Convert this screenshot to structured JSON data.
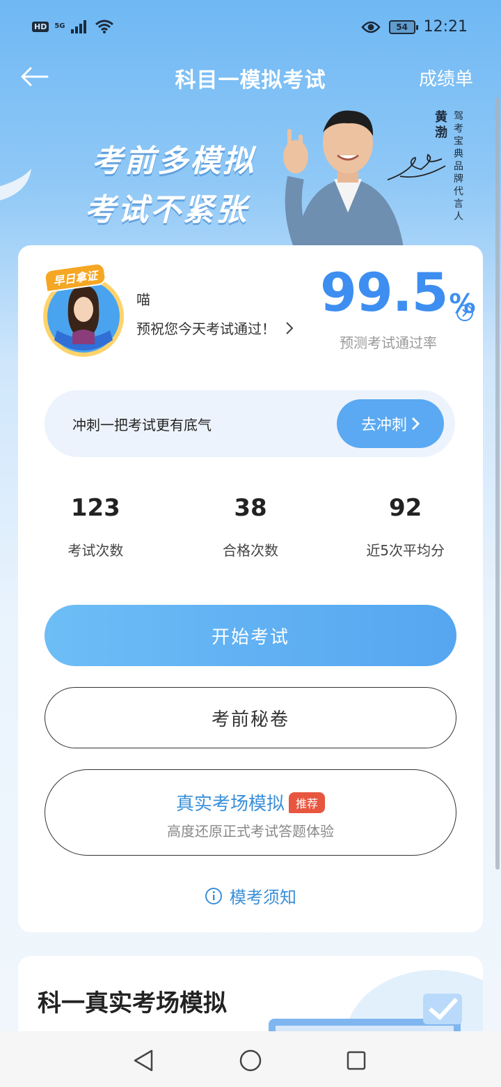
{
  "status_bar": {
    "hd": "HD",
    "network": "5G",
    "battery": "54",
    "time": "12:21"
  },
  "nav": {
    "title": "科目一模拟考试",
    "right_action": "成绩单"
  },
  "banner": {
    "slogan_line1": "考前多模拟",
    "slogan_line2": "考试不紧张",
    "celebrity_name": "黄渤",
    "endorsement": "驾考宝典品牌代言人"
  },
  "profile": {
    "badge": "早日拿证",
    "user_name": "喵",
    "wish": "预祝您今天考试通过！",
    "pass_rate": "99.5",
    "pass_rate_unit": "%",
    "pass_rate_label": "预测考试通过率"
  },
  "sprint": {
    "text": "冲刺一把考试更有底气",
    "button": "去冲刺"
  },
  "stats": [
    {
      "value": "123",
      "label": "考试次数"
    },
    {
      "value": "38",
      "label": "合格次数"
    },
    {
      "value": "92",
      "label": "近5次平均分"
    }
  ],
  "buttons": {
    "start_exam": "开始考试",
    "secret_paper": "考前秘卷",
    "real_exam_title": "真实考场模拟",
    "real_exam_badge": "推荐",
    "real_exam_sub": "高度还原正式考试答题体验",
    "notice": "模考须知"
  },
  "section2": {
    "title": "科一真实考场模拟"
  },
  "colors": {
    "accent": "#3d8ef0",
    "button_blue": "#5aa9f2",
    "badge_red": "#e7563f",
    "link_blue": "#3b8fd8"
  }
}
